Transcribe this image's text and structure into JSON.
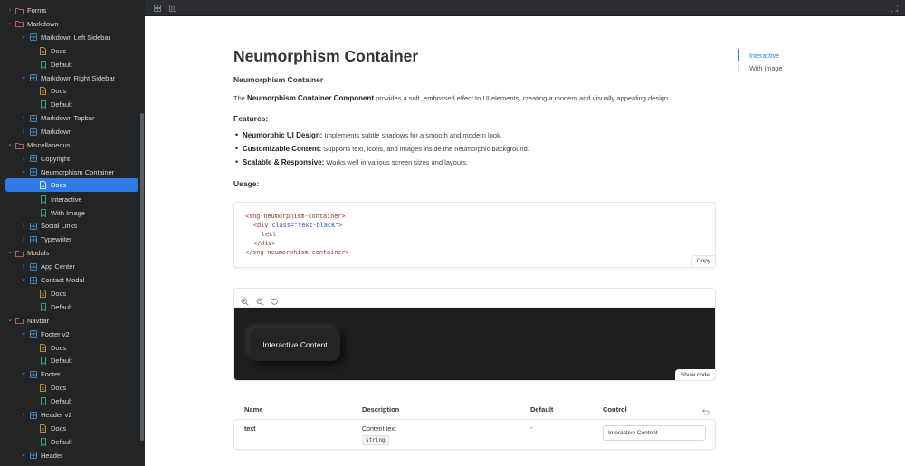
{
  "sidebar": {
    "items": [
      {
        "label": "Forms",
        "indent": 0,
        "type": "folder",
        "chevron": "right"
      },
      {
        "label": "Markdown",
        "indent": 0,
        "type": "folder",
        "chevron": "down"
      },
      {
        "label": "Markdown Left Sidebar",
        "indent": 1,
        "type": "component",
        "chevron": "down"
      },
      {
        "label": "Docs",
        "indent": 2,
        "type": "docs",
        "chevron": ""
      },
      {
        "label": "Default",
        "indent": 2,
        "type": "story",
        "chevron": ""
      },
      {
        "label": "Markdown Right Sidebar",
        "indent": 1,
        "type": "component",
        "chevron": "down"
      },
      {
        "label": "Docs",
        "indent": 2,
        "type": "docs",
        "chevron": ""
      },
      {
        "label": "Default",
        "indent": 2,
        "type": "story",
        "chevron": ""
      },
      {
        "label": "Markdown Topbar",
        "indent": 1,
        "type": "component",
        "chevron": "right"
      },
      {
        "label": "Markdown",
        "indent": 1,
        "type": "component",
        "chevron": "right"
      },
      {
        "label": "Miscellaneous",
        "indent": 0,
        "type": "folder",
        "chevron": "down"
      },
      {
        "label": "Copyright",
        "indent": 1,
        "type": "component",
        "chevron": "right"
      },
      {
        "label": "Neumorphism Container",
        "indent": 1,
        "type": "component",
        "chevron": "down"
      },
      {
        "label": "Docs",
        "indent": 2,
        "type": "docs",
        "chevron": "",
        "selected": true
      },
      {
        "label": "Interactive",
        "indent": 2,
        "type": "story",
        "chevron": ""
      },
      {
        "label": "With Image",
        "indent": 2,
        "type": "story",
        "chevron": ""
      },
      {
        "label": "Social Links",
        "indent": 1,
        "type": "component",
        "chevron": "right"
      },
      {
        "label": "Typewriter",
        "indent": 1,
        "type": "component",
        "chevron": "right"
      },
      {
        "label": "Modals",
        "indent": 0,
        "type": "folder",
        "chevron": "down"
      },
      {
        "label": "App Center",
        "indent": 1,
        "type": "component",
        "chevron": "right"
      },
      {
        "label": "Contact Modal",
        "indent": 1,
        "type": "component",
        "chevron": "down"
      },
      {
        "label": "Docs",
        "indent": 2,
        "type": "docs",
        "chevron": ""
      },
      {
        "label": "Default",
        "indent": 2,
        "type": "story",
        "chevron": ""
      },
      {
        "label": "Navbar",
        "indent": 0,
        "type": "folder",
        "chevron": "down"
      },
      {
        "label": "Footer v2",
        "indent": 1,
        "type": "component",
        "chevron": "down"
      },
      {
        "label": "Docs",
        "indent": 2,
        "type": "docs",
        "chevron": ""
      },
      {
        "label": "Default",
        "indent": 2,
        "type": "story",
        "chevron": ""
      },
      {
        "label": "Footer",
        "indent": 1,
        "type": "component",
        "chevron": "down"
      },
      {
        "label": "Docs",
        "indent": 2,
        "type": "docs",
        "chevron": ""
      },
      {
        "label": "Default",
        "indent": 2,
        "type": "story",
        "chevron": ""
      },
      {
        "label": "Header v2",
        "indent": 1,
        "type": "component",
        "chevron": "down"
      },
      {
        "label": "Docs",
        "indent": 2,
        "type": "docs",
        "chevron": ""
      },
      {
        "label": "Default",
        "indent": 2,
        "type": "story",
        "chevron": ""
      },
      {
        "label": "Header",
        "indent": 1,
        "type": "component",
        "chevron": "down"
      }
    ]
  },
  "doc": {
    "title": "Neumorphism Container",
    "subtitle": "Neumorphism Container",
    "intro_prefix": "The ",
    "intro_bold": "Neumorphism Container Component",
    "intro_suffix": " provides a soft, embossed effect to UI elements, creating a modern and visually appealing design.",
    "features_heading": "Features:",
    "features": [
      {
        "title": "Neumorphic UI Design:",
        "text": " Implements subtle shadows for a smooth and modern look."
      },
      {
        "title": "Customizable Content:",
        "text": " Supports text, icons, and images inside the neumorphic background."
      },
      {
        "title": "Scalable & Responsive:",
        "text": " Works well in various screen sizes and layouts."
      }
    ],
    "usage_heading": "Usage:",
    "code": {
      "line1": "<sng-neumorphism-container>",
      "line2_open": "<div ",
      "line2_attr": "class=",
      "line2_str": "\"text-black\"",
      "line2_close": ">",
      "line3": "text",
      "line4": "</div>",
      "line5": "</sng-neumorphism-container>",
      "copy_label": "Copy"
    },
    "preview": {
      "content": "Interactive Content",
      "show_code_label": "Show code"
    },
    "args_table": {
      "headers": {
        "name": "Name",
        "description": "Description",
        "default": "Default",
        "control": "Control"
      },
      "rows": [
        {
          "name": "text",
          "description": "Content text",
          "type": "string",
          "default": "-",
          "control_value": "Interactive Content"
        }
      ]
    }
  },
  "toc": {
    "items": [
      {
        "label": "Interactive",
        "active": true
      },
      {
        "label": "With Image",
        "active": false
      }
    ]
  },
  "colors": {
    "accent": "#2f7be3",
    "sidebar_bg": "#222426",
    "folder_icon": "#e06c75",
    "component_icon": "#4a9ee8",
    "docs_icon": "#e5a93a",
    "story_icon": "#3fbf7f"
  }
}
